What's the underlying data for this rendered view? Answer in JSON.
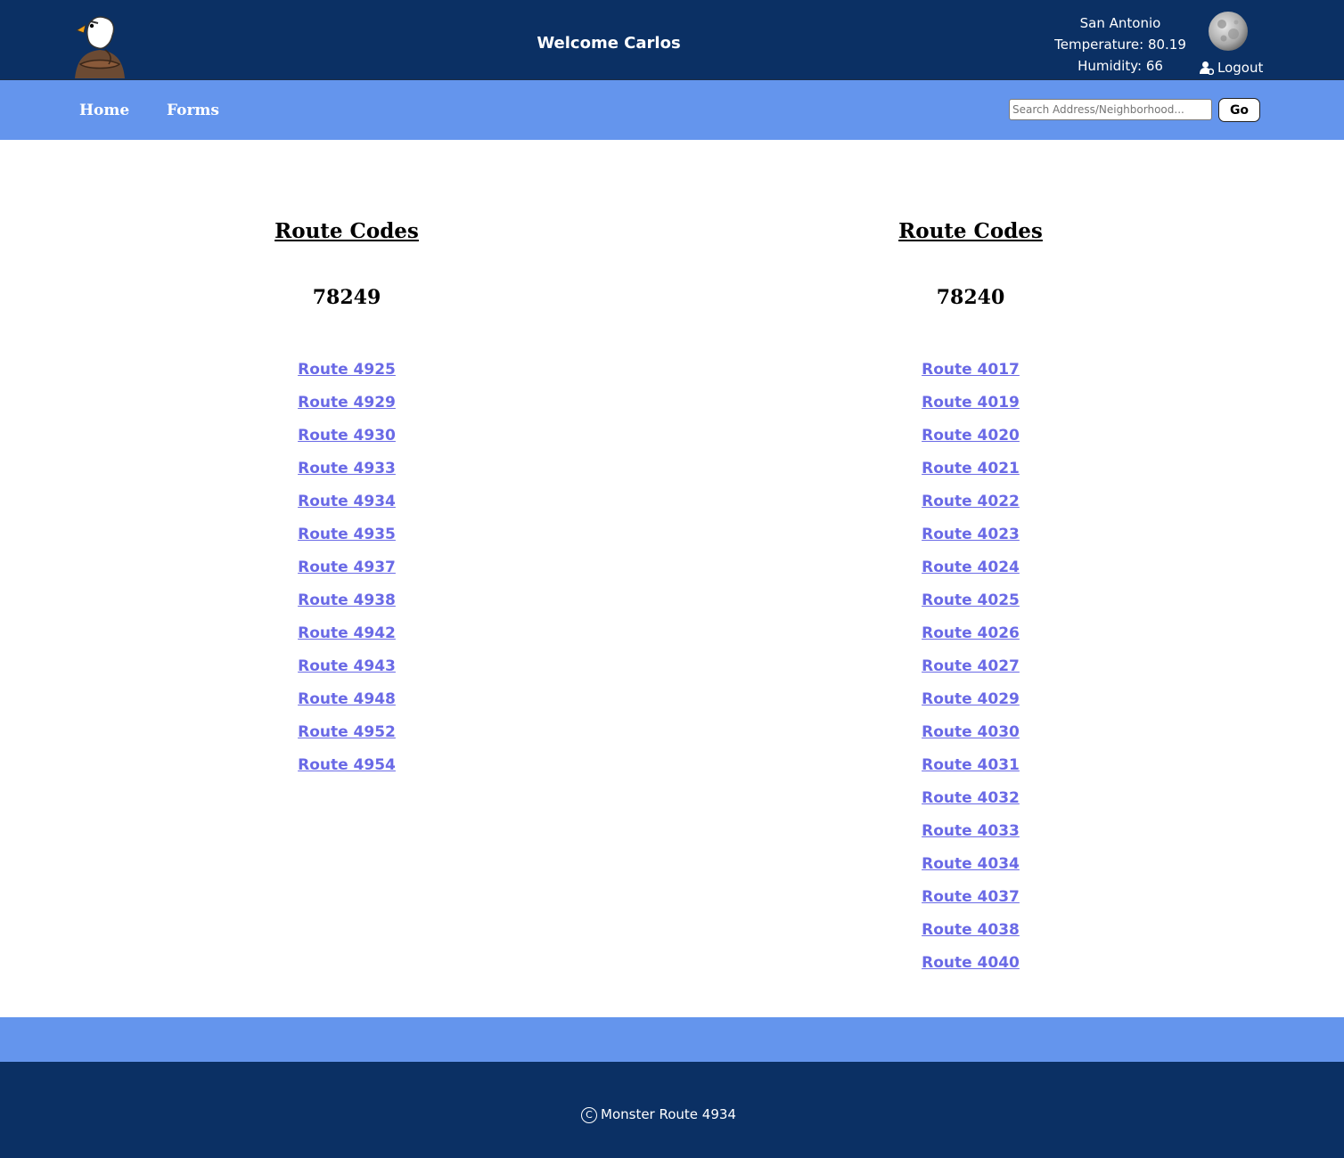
{
  "header": {
    "welcome": "Welcome Carlos",
    "weather": {
      "city": "San Antonio",
      "temperature": "Temperature: 80.19",
      "humidity": "Humidity: 66"
    },
    "logout_label": "Logout",
    "logo_icon": "eagle-mascot-logo",
    "weather_icon": "moon-icon"
  },
  "nav": {
    "items": [
      {
        "label": "Home"
      },
      {
        "label": "Forms"
      }
    ],
    "search_placeholder": "Search Address/Neighborhood...",
    "go_label": "Go"
  },
  "columns": [
    {
      "title": "Route Codes",
      "code": "78249",
      "routes": [
        "Route 4925",
        "Route 4929",
        "Route 4930",
        "Route 4933",
        "Route 4934",
        "Route 4935",
        "Route 4937",
        "Route 4938",
        "Route 4942",
        "Route 4943",
        "Route 4948",
        "Route 4952",
        "Route 4954"
      ]
    },
    {
      "title": "Route Codes",
      "code": "78240",
      "routes": [
        "Route 4017",
        "Route 4019",
        "Route 4020",
        "Route 4021",
        "Route 4022",
        "Route 4023",
        "Route 4024",
        "Route 4025",
        "Route 4026",
        "Route 4027",
        "Route 4029",
        "Route 4030",
        "Route 4031",
        "Route 4032",
        "Route 4033",
        "Route 4034",
        "Route 4037",
        "Route 4038",
        "Route 4040"
      ]
    }
  ],
  "footer": {
    "text": "Monster Route 4934"
  },
  "colors": {
    "header_bg": "#0b3064",
    "nav_bg": "#6495ed",
    "link": "#6a6ae6"
  }
}
